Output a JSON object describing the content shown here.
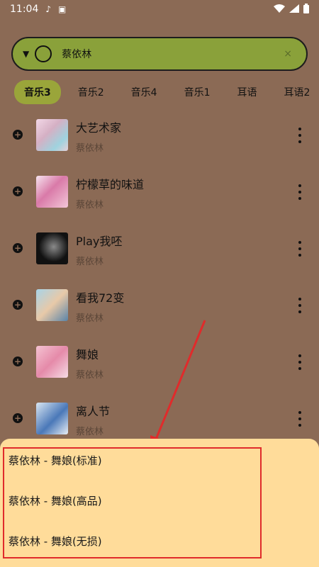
{
  "status": {
    "time": "11:04",
    "icons": [
      "music-note-icon",
      "a-icon",
      "wifi-icon",
      "signal-icon",
      "battery-icon"
    ]
  },
  "search": {
    "value": "蔡依林",
    "clear": "×"
  },
  "tabs": [
    {
      "label": "音乐3",
      "active": true
    },
    {
      "label": "音乐2"
    },
    {
      "label": "音乐4"
    },
    {
      "label": "音乐1"
    },
    {
      "label": "耳语"
    },
    {
      "label": "耳语2"
    }
  ],
  "songs": [
    {
      "title": "大艺术家",
      "artist": "蔡依林"
    },
    {
      "title": "柠檬草的味道",
      "artist": "蔡依林"
    },
    {
      "title": "Play我呸",
      "artist": "蔡依林"
    },
    {
      "title": "看我72变",
      "artist": "蔡依林"
    },
    {
      "title": "舞娘",
      "artist": "蔡依林"
    },
    {
      "title": "离人节",
      "artist": "蔡依林"
    }
  ],
  "options": [
    "蔡依林 - 舞娘(标准)",
    "蔡依林 - 舞娘(高品)",
    "蔡依林 - 舞娘(无损)"
  ],
  "colors": {
    "background": "#8b6a55",
    "accent_green": "#8aa13a",
    "sheet": "#ffdc9a",
    "highlight_red": "#e02b2b"
  }
}
